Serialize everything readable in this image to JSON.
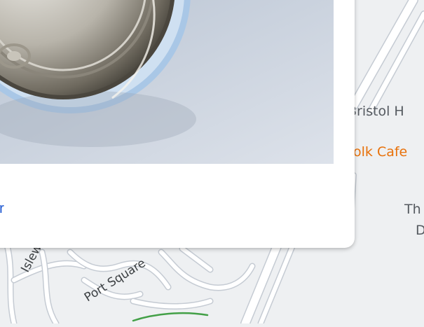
{
  "map": {
    "labels": {
      "bristol": "Bristol H",
      "cafe": "olk Cafe",
      "th": "Th",
      "d": "D",
      "islewood": "Islewood",
      "port_square": "Port Square",
      "left_road": "Is"
    },
    "colors": {
      "background": "#eef0f2",
      "road": "#ffffff",
      "road_outline": "#c5cbd3",
      "poi_label": "#e8710a",
      "green_path": "#43a047"
    }
  },
  "info_card": {
    "photo_subject": "top of a metal drink can with pull tab",
    "link_text": "er"
  }
}
